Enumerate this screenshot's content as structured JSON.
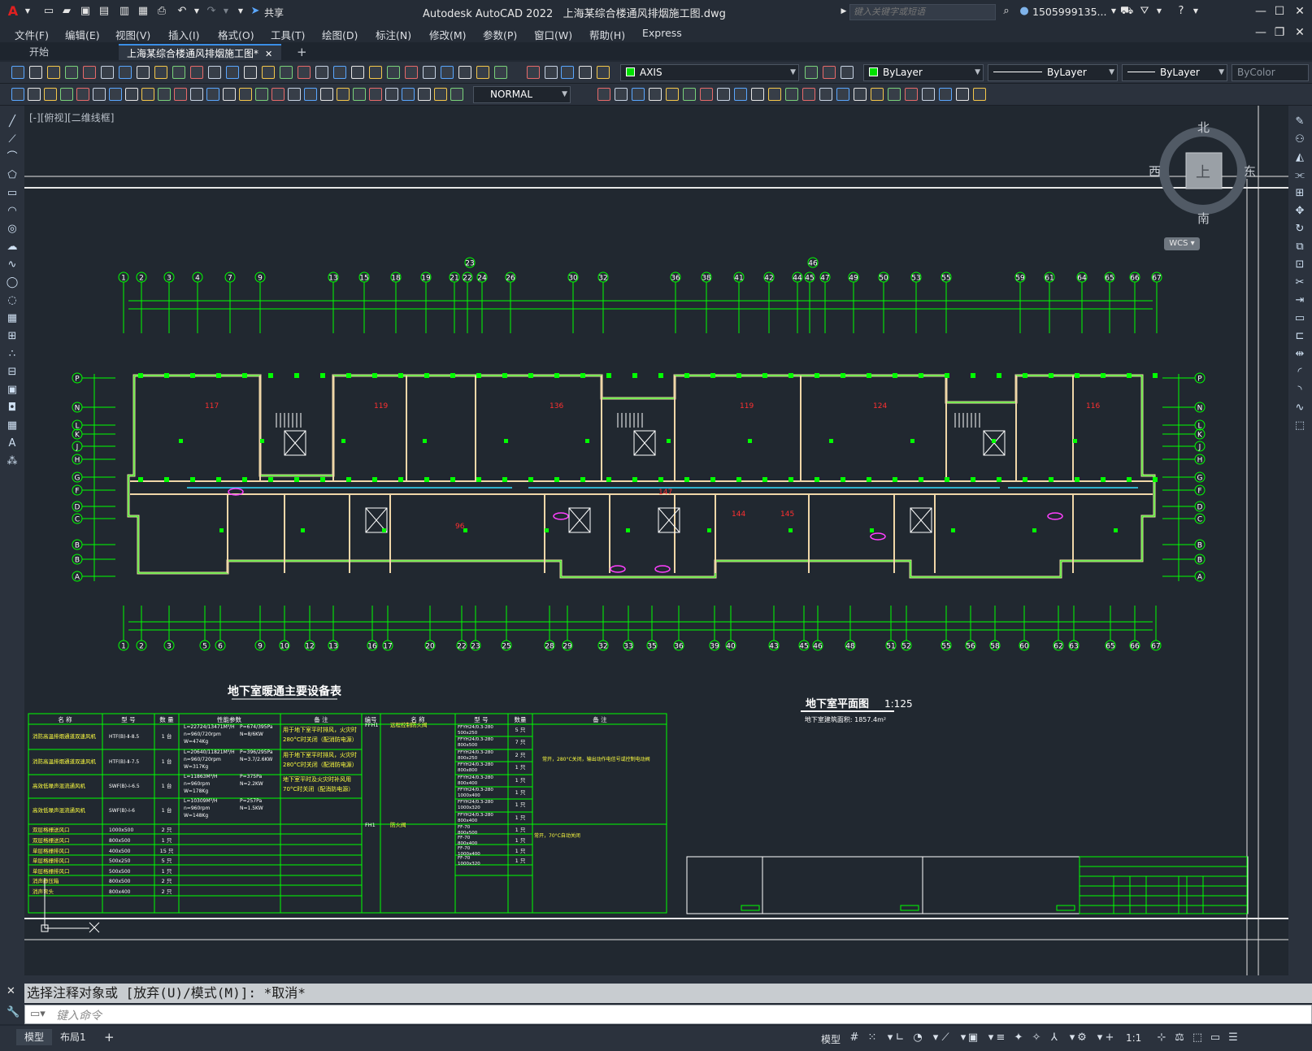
{
  "app": {
    "title": "Autodesk AutoCAD 2022",
    "filename": "上海某综合楼通风排烟施工图.dwg",
    "share": "共享",
    "search_placeholder": "键入关键字或短语",
    "user": "1505999135...",
    "logo": "A"
  },
  "menu": [
    "文件(F)",
    "编辑(E)",
    "视图(V)",
    "插入(I)",
    "格式(O)",
    "工具(T)",
    "绘图(D)",
    "标注(N)",
    "修改(M)",
    "参数(P)",
    "窗口(W)",
    "帮助(H)",
    "Express"
  ],
  "tabs": [
    {
      "label": "开始",
      "active": false
    },
    {
      "label": "上海某综合楼通风排烟施工图*",
      "active": true
    }
  ],
  "toolbar": {
    "layer": "AXIS",
    "color": "ByLayer",
    "linetype": "ByLayer",
    "lineweight": "ByLayer",
    "plotstyle": "ByColor",
    "dimstyle": "NORMAL",
    "layer_color": "#00e000"
  },
  "viewport": {
    "label": "[-][俯视][二维线框]"
  },
  "viewcube": {
    "north": "北",
    "south": "南",
    "east": "东",
    "west": "西",
    "top": "上",
    "wcs": "WCS"
  },
  "drawing": {
    "plan_title": "地下室平面图",
    "plan_scale": "1:125",
    "plan_area": "地下室建筑面积: 1857.4m²",
    "table_title": "地下室暖通主要设备表",
    "grid_top": [
      "1",
      "2",
      "3",
      "4",
      "7",
      "9",
      "13",
      "15",
      "18",
      "19",
      "21",
      "22",
      "24",
      "26",
      "30",
      "32",
      "36",
      "38",
      "41",
      "42",
      "44",
      "45",
      "47",
      "49",
      "50",
      "53",
      "55",
      "59",
      "61",
      "64",
      "65",
      "66",
      "67"
    ],
    "grid_bottom": [
      "1",
      "2",
      "3",
      "5",
      "6",
      "9",
      "10",
      "12",
      "13",
      "16",
      "17",
      "20",
      "22",
      "23",
      "25",
      "28",
      "29",
      "32",
      "33",
      "35",
      "36",
      "39",
      "40",
      "43",
      "45",
      "46",
      "48",
      "51",
      "52",
      "55",
      "56",
      "58",
      "60",
      "62",
      "63",
      "65",
      "66",
      "67"
    ],
    "grid_left": [
      "P",
      "N",
      "L",
      "K",
      "J",
      "H",
      "G",
      "F",
      "D",
      "C",
      "B",
      "B",
      "A"
    ],
    "grid_right": [
      "P",
      "N",
      "L",
      "K",
      "J",
      "H",
      "G",
      "F",
      "D",
      "C",
      "B",
      "B",
      "A"
    ],
    "grid_mid_top": "23",
    "grid_mid_top2": "46",
    "rooms": [
      "117",
      "119",
      "136",
      "119",
      "124",
      "116",
      "147",
      "144",
      "145",
      "96"
    ],
    "table_headers_left": [
      "名 称",
      "型 号",
      "数 量",
      "性能参数",
      "备 注"
    ],
    "table_headers_right": [
      "编号",
      "名 称",
      "型 号",
      "数量",
      "备 注"
    ],
    "table_rows_left": [
      [
        "消防高温排烟通道双速风机",
        "HTF(B)-Ⅱ-8.5",
        "1 台",
        "L=22724/13471M³/H n=960/720rpm W=474Kg",
        "P=674/395Pa N=8/6KW",
        "用于地下室平时排风，火灾时 280°C时关闭（配消防电源）"
      ],
      [
        "消防高温排烟通道双速风机",
        "HTF(B)-Ⅱ-7.5",
        "1 台",
        "L=20640/11821M³/H n=960/720rpm W=317Kg",
        "P=396/295Pa N=3.7/2.6KW",
        "用于地下室平时排风，火灾时 280°C时关闭（配消防电源）"
      ],
      [
        "高效低噪声混流通风机",
        "SWF(B)-Ⅰ-6.5",
        "1 台",
        "L=11863M³/H n=960rpm W=178Kg",
        "P=375Pa N=2.2KW",
        "地下室平时及火灾时补风用 70°C时关闭（配消防电源）"
      ],
      [
        "高效低噪声混流通风机",
        "SWF(B)-Ⅰ-6",
        "1 台",
        "L=10309M³/H n=960rpm W=148Kg",
        "P=257Pa N=1.5KW",
        ""
      ],
      [
        "双层格栅送风口",
        "1000x500",
        "2 只",
        "",
        "",
        ""
      ],
      [
        "双层格栅送风口",
        "800x500",
        "1 只",
        "",
        "",
        ""
      ],
      [
        "单层格栅排风口",
        "400x500",
        "15 只",
        "",
        "",
        ""
      ],
      [
        "单层格栅排风口",
        "500x250",
        "5 只",
        "",
        "",
        ""
      ],
      [
        "单层格栅排风口",
        "500x500",
        "1 只",
        "",
        "",
        ""
      ],
      [
        "消声静压箱",
        "800x500",
        "2 只",
        "",
        "",
        ""
      ],
      [
        "消声弯头",
        "800x400",
        "2 只",
        "",
        "",
        ""
      ]
    ],
    "table_rows_right": [
      [
        "FFH1",
        "远程控制防火阀",
        "FFYH24/0.3-280 500x250",
        "5 只"
      ],
      [
        "",
        "",
        "FFYH24/0.3-280 800x500",
        "7 只"
      ],
      [
        "",
        "",
        "FFYH24/0.3-280 800x250",
        "2 只"
      ],
      [
        "",
        "",
        "FFYH24/0.3-280 800x800",
        "1 只"
      ],
      [
        "",
        "",
        "FFYH24/0.3-280 800x400",
        "1 只"
      ],
      [
        "",
        "",
        "FFYH24/0.3-280 1000x400",
        "1 只"
      ],
      [
        "",
        "",
        "FFYH24/0.3-280 1000x320",
        "1 只"
      ],
      [
        "",
        "",
        "FFYH24/0.3-280 800x400",
        "1 只"
      ],
      [
        "FH1",
        "防火阀",
        "FF-70 800x500",
        "1 只"
      ],
      [
        "",
        "",
        "FF-70 800x400",
        "1 只"
      ],
      [
        "",
        "",
        "FF-70 1000x400",
        "1 只"
      ],
      [
        "",
        "",
        "FF-70 1000x320",
        "1 只"
      ]
    ],
    "table_right_notes": [
      "常开，280°C关闭，输出动作电信号或控制电动阀",
      "常开，70°C自动关闭"
    ]
  },
  "command": {
    "history": "选择注释对象或 [放弃(U)/模式(M)]: *取消*",
    "placeholder": "键入命令"
  },
  "status": {
    "tabs": [
      {
        "label": "模型",
        "active": true
      },
      {
        "label": "布局1",
        "active": false
      }
    ],
    "mode": "模型",
    "scale": "1:1"
  }
}
